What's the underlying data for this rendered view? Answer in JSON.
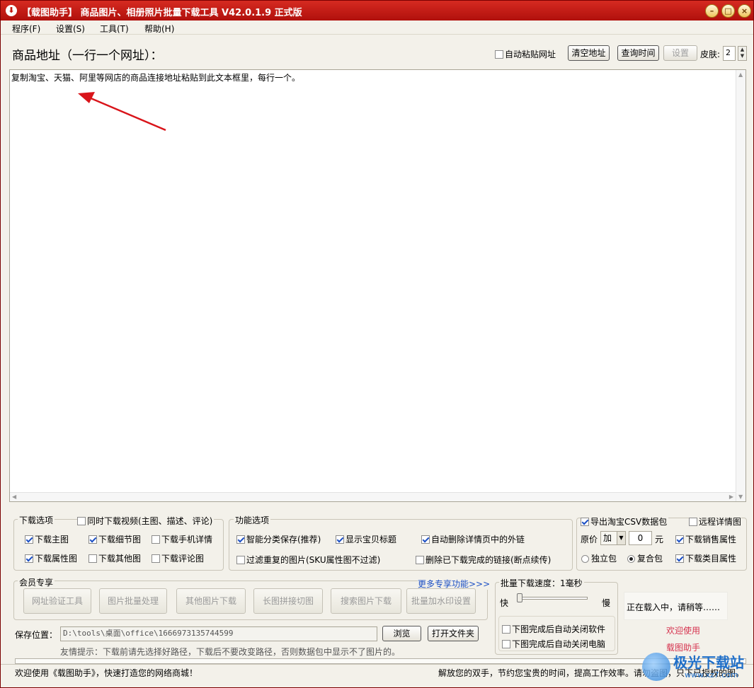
{
  "window": {
    "title": "【载图助手】 商品图片、相册照片批量下载工具 V42.0.1.9 正式版",
    "controls": {
      "minimize": "–",
      "maximize": "□",
      "close": "×"
    }
  },
  "menu": [
    "程序(F)",
    "设置(S)",
    "工具(T)",
    "帮助(H)"
  ],
  "header": {
    "url_label": "商品地址（一行一个网址）：",
    "auto_paste": {
      "label": "自动粘贴网址",
      "checked": false
    },
    "clear_button": "清空地址",
    "query_time_button": "查询时间",
    "settings_button": "设置",
    "skin_label": "皮肤:",
    "skin_value": "2"
  },
  "editor": {
    "text": "复制淘宝、天猫、阿里等网店的商品连接地址粘贴到此文本框里，每行一个。"
  },
  "download_options": {
    "title": "下载选项",
    "video": {
      "label": "同时下载视频(主图、描述、评论)",
      "checked": false
    },
    "items": [
      {
        "label": "下载主图",
        "checked": true
      },
      {
        "label": "下载细节图",
        "checked": true
      },
      {
        "label": "下载手机详情",
        "checked": false
      },
      {
        "label": "下载属性图",
        "checked": true
      },
      {
        "label": "下载其他图",
        "checked": false
      },
      {
        "label": "下载评论图",
        "checked": false
      }
    ]
  },
  "function_options": {
    "title": "功能选项",
    "items": [
      {
        "label": "智能分类保存(推荐)",
        "checked": true
      },
      {
        "label": "显示宝贝标题",
        "checked": true
      },
      {
        "label": "自动删除详情页中的外链",
        "checked": true
      },
      {
        "label": "过滤重复的图片(SKU属性图不过滤)",
        "checked": false
      },
      {
        "label": "删除已下载完成的链接(断点续传)",
        "checked": false
      }
    ]
  },
  "csv_options": {
    "export_csv": {
      "label": "导出淘宝CSV数据包",
      "checked": true
    },
    "remote_detail": {
      "label": "远程详情图",
      "checked": false
    },
    "price_label": "原价",
    "price_op": "加",
    "price_value": "0",
    "price_unit": "元",
    "sales_attr": {
      "label": "下载销售属性",
      "checked": true
    },
    "pkg_single": {
      "label": "独立包",
      "selected": false
    },
    "pkg_combined": {
      "label": "复合包",
      "selected": true
    },
    "category_attr": {
      "label": "下载类目属性",
      "checked": true
    }
  },
  "member": {
    "title": "会员专享",
    "more": "更多专享功能>>>",
    "buttons": [
      "网址验证工具",
      "图片批量处理",
      "其他图片下载",
      "长图拼接切图",
      "搜索图片下载",
      "批量加水印设置"
    ]
  },
  "speed": {
    "title": "批量下载速度：1毫秒",
    "fast": "快",
    "slow": "慢",
    "close_app": {
      "label": "下图完成后自动关闭软件",
      "checked": false
    },
    "shutdown": {
      "label": "下图完成后自动关闭电脑",
      "checked": false
    }
  },
  "save": {
    "label": "保存位置：",
    "path": "D:\\tools\\桌面\\office\\1666973135744599",
    "browse": "浏览",
    "open_folder": "打开文件夹",
    "tip": "友情提示：下载前请先选择好路径，下载后不要改变路径，否则数据包中显示不了图片的。"
  },
  "status": {
    "loading": "正在载入中，请稍等……",
    "welcome": "欢迎使用",
    "app_name": "载图助手",
    "left": "欢迎使用《载图助手》，快速打造您的网络商城！",
    "right": "解放您的双手，节约您宝贵的时间，提高工作效率。请勿盗图，只下已授权的图。"
  },
  "watermark": {
    "brand": "极光下载站",
    "url": "www.xz7.com"
  },
  "colors": {
    "titlebar": "#c4170f",
    "arrow": "#d9141a",
    "welcome": "#d6334f",
    "link_blue": "#1b4fc4"
  }
}
